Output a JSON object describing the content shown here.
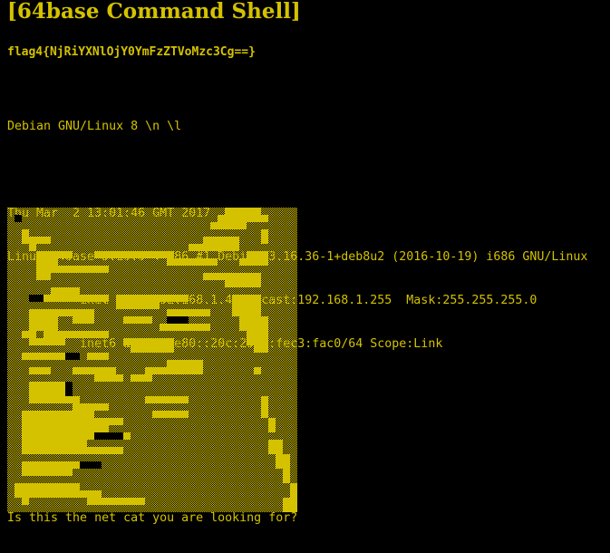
{
  "page": {
    "title": "[64base Command Shell]",
    "flag": "flag4{NjRiYXNlOjY0YmFzZTVoMzc3Cg==}"
  },
  "terminal": {
    "lines": [
      "Debian GNU/Linux 8 \\n \\l",
      "",
      "Thu Mar  2 13:01:46 GMT 2017",
      "Linux 64base 3.16.0-4-586 #1 Debian 3.16.36-1+deb8u2 (2016-10-19) i686 GNU/Linux",
      "          inet addr:192.168.1.40  Bcast:192.168.1.255  Mask:255.255.255.0",
      "          inet6 addr: fe80::20c:29ff:fec3:fac0/64 Scope:Link"
    ]
  },
  "ascii_art": {
    "subject": "cat",
    "foreground": "#d4c200",
    "background": "#000000"
  },
  "prompt": {
    "text": "Is this the net cat you are looking for?"
  },
  "colors": {
    "text": "#d4c200",
    "background": "#000000"
  }
}
